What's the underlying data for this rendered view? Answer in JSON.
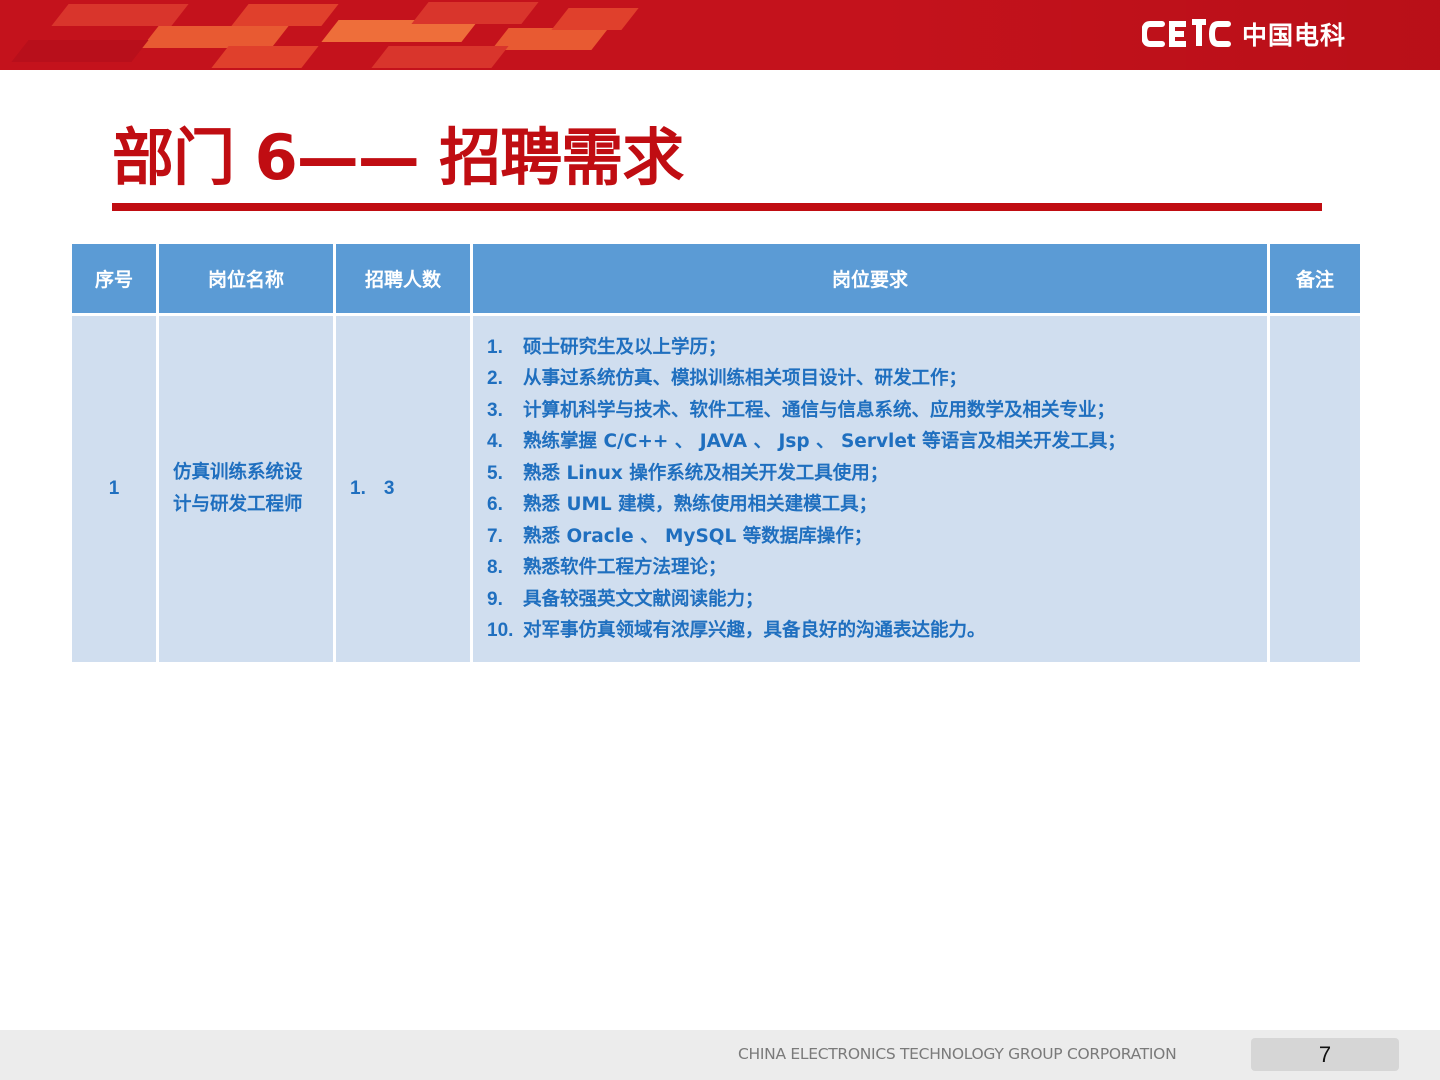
{
  "header": {
    "logo_text": "CETC",
    "logo_cn": "中国电科"
  },
  "title": "部门 6—— 招聘需求",
  "table": {
    "headers": [
      "序号",
      "岗位名称",
      "招聘人数",
      "岗位要求",
      "备注"
    ],
    "row": {
      "index": "1",
      "position": "仿真训练系统设计与研发工程师",
      "count_prefix": "1.",
      "count": "3",
      "requirements": [
        {
          "num": "1.",
          "text": "硕士研究生及以上学历；"
        },
        {
          "num": "2.",
          "text": "从事过系统仿真、模拟训练相关项目设计、研发工作；"
        },
        {
          "num": "3.",
          "text": "计算机科学与技术、软件工程、通信与信息系统、应用数学及相关专业；"
        },
        {
          "num": "4.",
          "text": "熟练掌握 C/C++ 、 JAVA 、 Jsp 、 Servlet 等语言及相关开发工具；"
        },
        {
          "num": "5.",
          "text": "熟悉 Linux 操作系统及相关开发工具使用；"
        },
        {
          "num": "6.",
          "text": "熟悉 UML 建模，熟练使用相关建模工具；"
        },
        {
          "num": "7.",
          "text": "熟悉 Oracle 、 MySQL 等数据库操作；"
        },
        {
          "num": "8.",
          "text": "熟悉软件工程方法理论；"
        },
        {
          "num": "9.",
          "text": "具备较强英文文献阅读能力；"
        },
        {
          "num": "10.",
          "text": "对军事仿真领域有浓厚兴趣，具备良好的沟通表达能力。"
        }
      ],
      "remark": ""
    }
  },
  "footer": {
    "company": "CHINA ELECTRONICS TECHNOLOGY GROUP CORPORATION",
    "page_number": "7"
  },
  "colors": {
    "brand_red": "#c4121c",
    "title_red": "#c00d12",
    "header_blue": "#5b9bd5",
    "cell_blue": "#d0deef",
    "text_blue": "#1f6fbf"
  }
}
